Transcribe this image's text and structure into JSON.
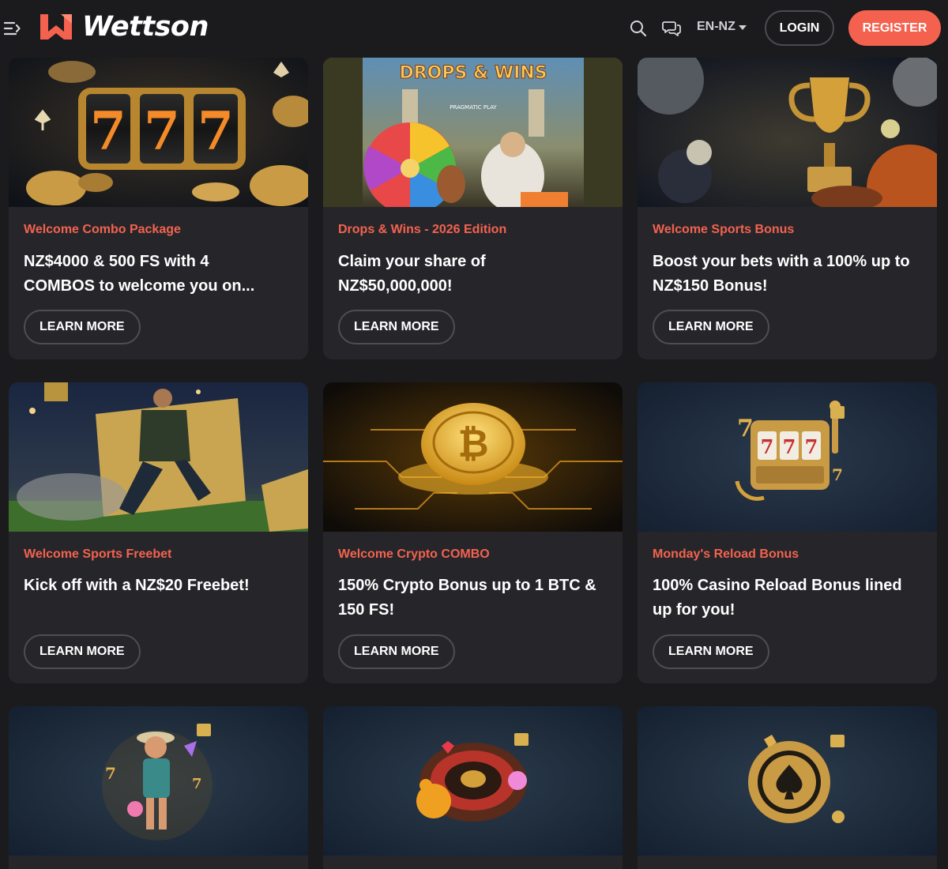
{
  "header": {
    "brand": "Wettson",
    "language": "EN-NZ",
    "login_label": "LOGIN",
    "register_label": "REGISTER",
    "icons": [
      "menu-icon",
      "search-icon",
      "chat-icon",
      "caret-down-icon"
    ]
  },
  "colors": {
    "accent": "#f4624f",
    "background": "#1b1b1e",
    "card": "#26262a"
  },
  "promos": [
    {
      "tag": "Welcome Combo Package",
      "title": "NZ$4000 & 500 FS with 4 COMBOS to welcome you on...",
      "cta": "LEARN MORE",
      "image": "slot-777-coins"
    },
    {
      "tag": "Drops & Wins - 2026 Edition",
      "title": "Claim your share of NZ$50,000,000!",
      "cta": "LEARN MORE",
      "image": "drops-wins-zeus-wheel",
      "image_text": "DROPS & WINS",
      "image_subtext": "PRAGMATIC PLAY"
    },
    {
      "tag": "Welcome Sports Bonus",
      "title": "Boost your bets with a 100% up to NZ$150 Bonus!",
      "cta": "LEARN MORE",
      "image": "gold-trophy-balls"
    },
    {
      "tag": "Welcome Sports Freebet",
      "title": "Kick off with a NZ$20 Freebet!",
      "cta": "LEARN MORE",
      "image": "football-player-ticket"
    },
    {
      "tag": "Welcome Crypto COMBO",
      "title": "150% Crypto Bonus up to 1 BTC & 150 FS!",
      "cta": "LEARN MORE",
      "image": "bitcoin-circuit"
    },
    {
      "tag": "Monday's Reload Bonus",
      "title": "100% Casino Reload Bonus lined up for you!",
      "cta": "LEARN MORE",
      "image": "slot-machine-calendar"
    },
    {
      "image": "cowboy-character"
    },
    {
      "image": "roulette-candy"
    },
    {
      "image": "poker-chip-spade"
    }
  ]
}
